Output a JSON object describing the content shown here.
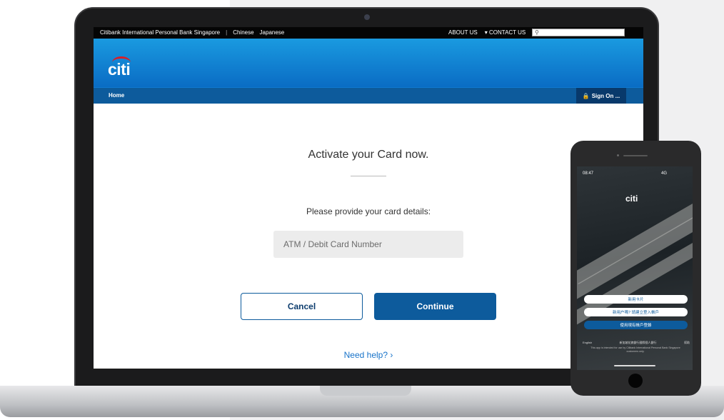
{
  "topbar": {
    "site_name": "Citibank International Personal Bank Singapore",
    "separator": "|",
    "lang_chinese": "Chinese",
    "lang_japanese": "Japanese",
    "about_us": "ABOUT US",
    "contact_us": "CONTACT US",
    "search_placeholder": ""
  },
  "brand": {
    "logo_text": "citi"
  },
  "nav": {
    "home": "Home",
    "sign_on": "Sign On ..."
  },
  "main": {
    "title": "Activate your Card now.",
    "prompt": "Please provide your card details:",
    "card_input_placeholder": "ATM / Debit Card Number",
    "cancel_label": "Cancel",
    "continue_label": "Continue",
    "help_label": "Need help? ›"
  },
  "phone": {
    "time": "08:47",
    "status_right": "4G",
    "logo_text": "citi",
    "button1": "新用卡片",
    "button2": "新用户嗎? 請建立登入帳戶",
    "button3": "使用現有帳戶登錄",
    "footer_left": "English",
    "footer_mid": "新加坡花旗銀行國際個人銀行",
    "footer_right": "幫助",
    "fine_print": "This app is intended for use by Citibank International Personal Bank Singapore customers only."
  },
  "colors": {
    "brand_blue": "#0d5b9c",
    "header_gradient_top": "#1a9ae0",
    "link_blue": "#1873c9",
    "citi_arc_red": "#d71e28"
  }
}
